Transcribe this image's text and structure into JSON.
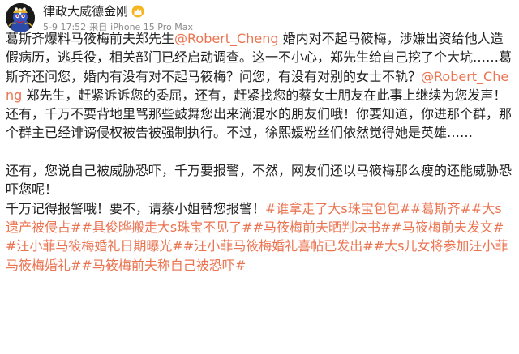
{
  "author": {
    "name": "律政大威德金刚",
    "avatar_icon": "tibetan-deity-avatar-icon",
    "badge_icon": "gold-crown-badge-icon"
  },
  "meta": {
    "time": "5-9 17:52",
    "source_prefix": "来自",
    "device": "iPhone 15 Pro Max"
  },
  "colors": {
    "link": "#eb7350",
    "meta_text": "#8a8a8a",
    "body_text": "#222222"
  },
  "post": {
    "p1": {
      "t1": "葛斯齐爆料马筱梅前夫郑先生",
      "mention1": "@Robert_Cheng",
      "t2": " 婚内对不起马筱梅，涉嫌出资给他人造假病历，逃兵役，相关部门已经启动调查。这一不小心，郑先生给自己挖了个大坑……葛斯齐还问您，婚内有没有对不起马筱梅？问您，有没有对别的女士不轨？",
      "mention2": "@Robert_Cheng",
      "t3": " 郑先生，赶紧诉诉您的委屈，还有，赶紧找您的蔡女士朋友在此事上继续为您发声！还有，千万不要背地里骂那些鼓舞您出来淌混水的朋友们哦！你要知道，你进那个群，那个群主已经诽谤侵权被告被强制执行。不过，徐熙媛粉丝们依然觉得她是英雄……"
    },
    "p2": {
      "t1": "还有，您说自己被威胁恐吓，千万要报警，不然，网友们还以马筱梅那么瘦的还能威胁恐吓您呢！"
    },
    "p3": {
      "t1": "千万记得报警哦！要不，请蔡小姐替您报警！",
      "hashtags": [
        "#谁拿走了大s珠宝包包#",
        "#葛斯齐##大s遗产被侵占#",
        "#具俊晔搬走大s珠宝不见了#",
        "#马筱梅前夫晒判决书#",
        "#马筱梅前夫发文#",
        "#汪小菲马筱梅婚礼日期曝光#",
        "#汪小菲马筱梅婚礼喜帖已发出#",
        "#大s儿女将参加汪小菲马筱梅婚礼#",
        "#马筱梅前夫称自己被恐吓#"
      ]
    }
  }
}
